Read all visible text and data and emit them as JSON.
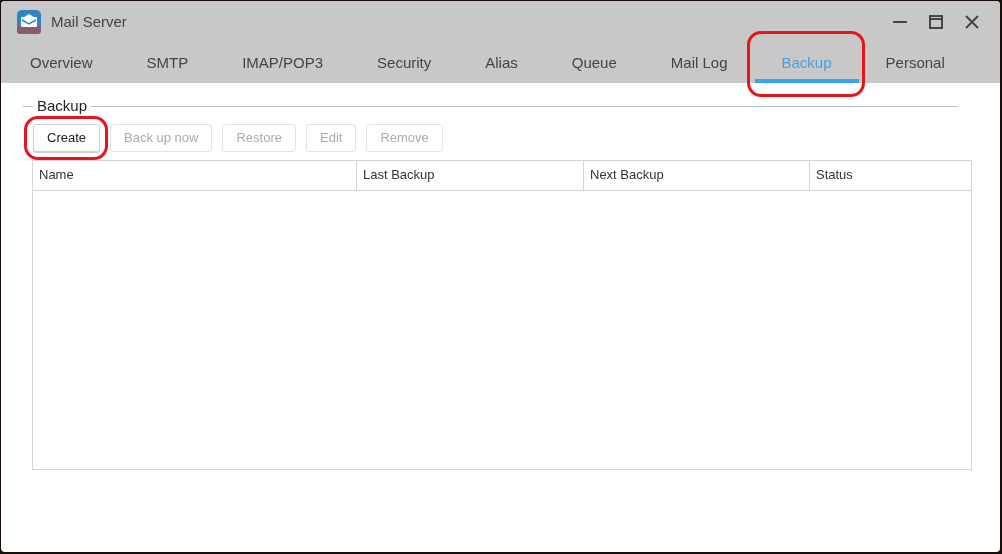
{
  "window": {
    "title": "Mail Server"
  },
  "tabs": [
    {
      "label": "Overview",
      "selected": false,
      "highlighted": false
    },
    {
      "label": "SMTP",
      "selected": false,
      "highlighted": false
    },
    {
      "label": "IMAP/POP3",
      "selected": false,
      "highlighted": false
    },
    {
      "label": "Security",
      "selected": false,
      "highlighted": false
    },
    {
      "label": "Alias",
      "selected": false,
      "highlighted": false
    },
    {
      "label": "Queue",
      "selected": false,
      "highlighted": false
    },
    {
      "label": "Mail Log",
      "selected": false,
      "highlighted": false
    },
    {
      "label": "Backup",
      "selected": true,
      "highlighted": true
    },
    {
      "label": "Personal",
      "selected": false,
      "highlighted": false
    }
  ],
  "section": {
    "title": "Backup"
  },
  "toolbar": [
    {
      "label": "Create",
      "disabled": false,
      "highlighted": true
    },
    {
      "label": "Back up now",
      "disabled": true,
      "highlighted": false
    },
    {
      "label": "Restore",
      "disabled": true,
      "highlighted": false
    },
    {
      "label": "Edit",
      "disabled": true,
      "highlighted": false
    },
    {
      "label": "Remove",
      "disabled": true,
      "highlighted": false
    }
  ],
  "table": {
    "columns": [
      "Name",
      "Last Backup",
      "Next Backup",
      "Status"
    ]
  }
}
